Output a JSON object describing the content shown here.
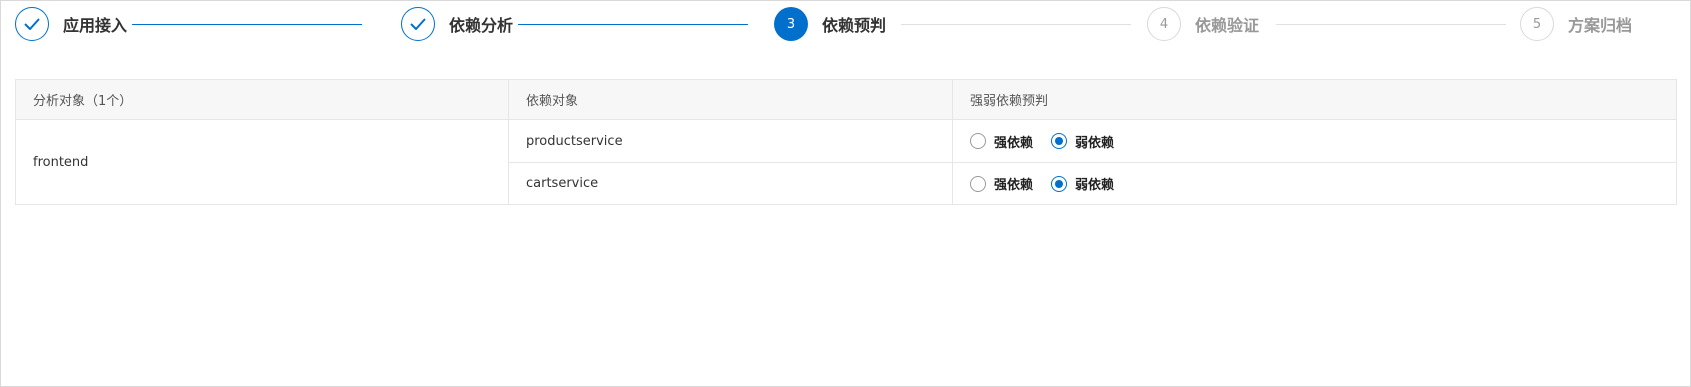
{
  "steps": [
    {
      "label": "应用接入",
      "state": "done"
    },
    {
      "label": "依赖分析",
      "state": "done"
    },
    {
      "number": "3",
      "label": "依赖预判",
      "state": "active"
    },
    {
      "number": "4",
      "label": "依赖验证",
      "state": "todo"
    },
    {
      "number": "5",
      "label": "方案归档",
      "state": "todo"
    }
  ],
  "table": {
    "headers": [
      "分析对象（1个）",
      "依赖对象",
      "强弱依赖预判"
    ],
    "analysis_object": "frontend",
    "rows": [
      {
        "dependency": "productservice",
        "options": [
          "强依赖",
          "弱依赖"
        ],
        "selected": "弱依赖"
      },
      {
        "dependency": "cartservice",
        "options": [
          "强依赖",
          "弱依赖"
        ],
        "selected": "弱依赖"
      }
    ]
  },
  "colors": {
    "accent": "#0070cc",
    "todo": "#999999"
  }
}
